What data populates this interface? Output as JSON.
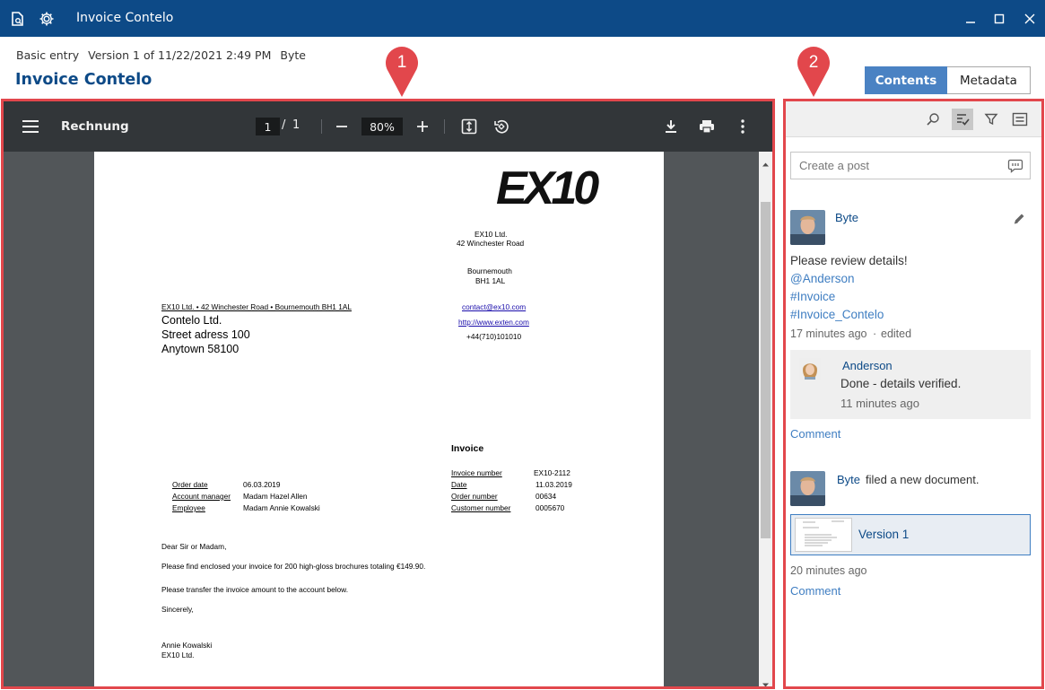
{
  "window": {
    "title": "Invoice Contelo"
  },
  "header": {
    "entry_type": "Basic entry",
    "version": "Version 1 of 11/22/2021 2:49 PM",
    "user": "Byte",
    "doc_title": "Invoice Contelo",
    "tabs": [
      {
        "label": "Contents",
        "active": true
      },
      {
        "label": "Metadata",
        "active": false
      }
    ]
  },
  "callouts": [
    "1",
    "2"
  ],
  "viewer": {
    "doc_label": "Rechnung",
    "page_current": "1",
    "page_sep": "/",
    "page_total": "1",
    "zoom": "80%"
  },
  "invoice": {
    "logo_text": "EX10",
    "company_name": "EX10 Ltd.",
    "company_street": "42 Winchester Road",
    "company_city": "Bournemouth",
    "company_postcode": "BH1 1AL",
    "sender_line": "EX10 Ltd. • 42 Winchester Road • Bournemouth BH1 1AL",
    "email": "contact@ex10.com",
    "website": "http://www.exten.com",
    "phone": "+44(710)101010",
    "recipient_name": "Contelo Ltd.",
    "recipient_street": "Street adress 100",
    "recipient_city": "Anytown 58100",
    "heading": "Invoice",
    "left_fields": [
      {
        "label": "Order date",
        "value": "06.03.2019"
      },
      {
        "label": "Account manager",
        "value": "Madam Hazel Allen"
      },
      {
        "label": "Employee",
        "value": "Madam Annie Kowalski"
      }
    ],
    "right_fields": [
      {
        "label": "Invoice number",
        "value": "EX10-2112"
      },
      {
        "label": "Date",
        "value": "11.03.2019"
      },
      {
        "label": "Order number",
        "value": "00634"
      },
      {
        "label": "Customer number",
        "value": "0005670"
      }
    ],
    "salutation": "Dear Sir or Madam,",
    "body1": "Please find enclosed your invoice for 200 high-gloss brochures totaling €149.90.",
    "body2": "Please transfer the invoice amount to the account below.",
    "closing": "Sincerely,",
    "signer": "Annie Kowalski",
    "signer_company": "EX10 Ltd."
  },
  "feed": {
    "create_placeholder": "Create a post",
    "post1": {
      "author": "Byte",
      "text": "Please review details!",
      "tags": [
        "@Anderson",
        "#Invoice",
        "#Invoice_Contelo"
      ],
      "time": "17 minutes ago",
      "dot": "·",
      "edited": "edited",
      "reply": {
        "author": "Anderson",
        "text": "Done - details verified.",
        "time": "11 minutes ago"
      },
      "comment_label": "Comment"
    },
    "post2": {
      "author": "Byte",
      "action": "filed a new document.",
      "version_label": "Version 1",
      "time": "20 minutes ago",
      "comment_label": "Comment"
    }
  },
  "colors": {
    "titlebar": "#0d4a87",
    "accent": "#4a82c3",
    "link": "#3f7ec2",
    "callout": "#e2474c",
    "pdf_toolbar": "#323639"
  }
}
